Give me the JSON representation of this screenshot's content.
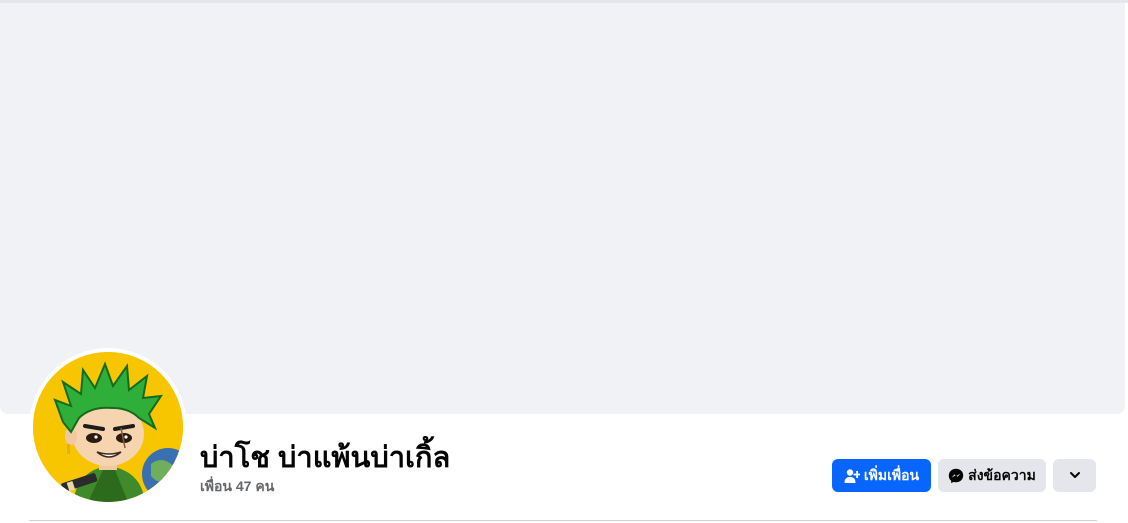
{
  "profile": {
    "name": "บ่าโช บ่าแพ้นบ่าเกิ้ล",
    "friends_text": "เพื่อน 47 คน"
  },
  "actions": {
    "add_friend_label": "เพิ่มเพื่อน",
    "message_label": "ส่งข้อความ",
    "more_icon": "chevron-down-icon"
  },
  "icons": {
    "add_friend": "person-plus-icon",
    "message": "messenger-icon"
  },
  "colors": {
    "primary": "#0866ff",
    "secondary_button": "#e4e6eb",
    "cover": "#f0f2f5",
    "name_text": "#050505",
    "subtext": "#65676b"
  }
}
